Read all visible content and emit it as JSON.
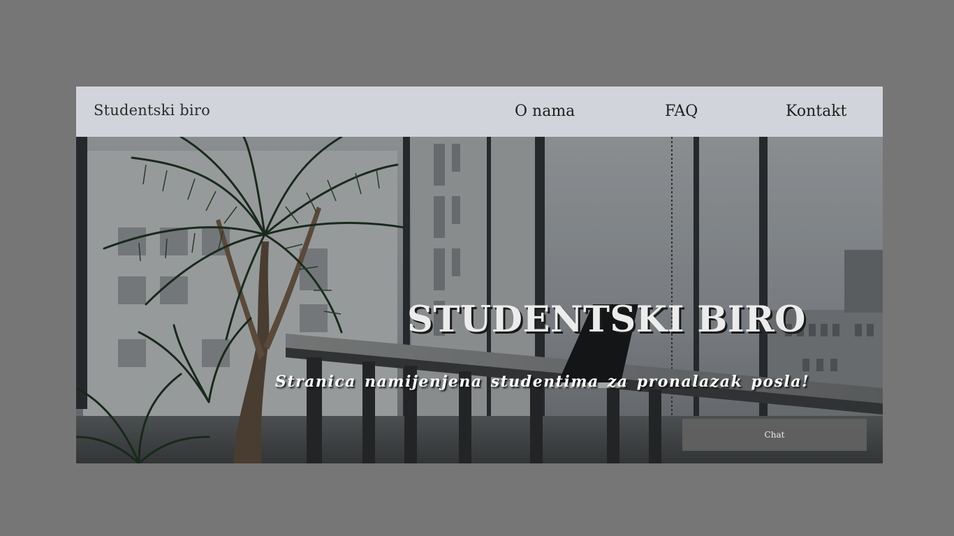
{
  "navbar": {
    "brand": "Studentski biro",
    "links": [
      {
        "label": "O nama"
      },
      {
        "label": "FAQ"
      },
      {
        "label": "Kontakt"
      }
    ]
  },
  "hero": {
    "title": "STUDENTSKI BIRO",
    "subtitle": "Stranica namijenjena studentima za pronalazak posla!",
    "background_image": "office-with-plants-photo"
  },
  "chat": {
    "label": "Chat"
  },
  "colors": {
    "page_background": "#767676",
    "navbar_background": "#d1d5db",
    "chat_button": "#626262"
  }
}
